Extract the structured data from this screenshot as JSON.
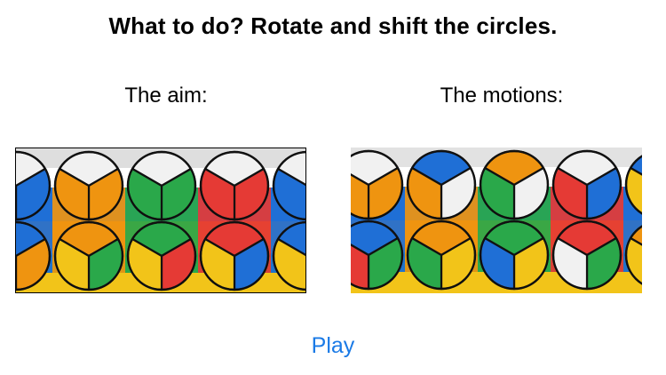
{
  "header": {
    "title": "What to do? Rotate and shift the circles."
  },
  "boards": {
    "aim": {
      "label": "The aim:",
      "backgrounds": [
        "#dedede",
        "#ffffff",
        "#1f6fd6",
        "#ef9410",
        "#2aa84a",
        "#e53a35",
        "#f2c419"
      ],
      "circles": [
        [
          "white",
          "blue",
          "blue"
        ],
        [
          "white",
          "orange",
          "orange"
        ],
        [
          "white",
          "green",
          "green"
        ],
        [
          "white",
          "red",
          "red"
        ],
        [
          "white",
          "blue",
          "blue"
        ],
        [
          "blue",
          "orange",
          "yellow"
        ],
        [
          "orange",
          "green",
          "yellow"
        ],
        [
          "green",
          "red",
          "yellow"
        ],
        [
          "red",
          "blue",
          "yellow"
        ],
        [
          "blue",
          "blue",
          "yellow"
        ]
      ]
    },
    "motions": {
      "label": "The motions:",
      "backgrounds": [
        "#e2e2e2",
        "#ffffff",
        "#1f6fd6",
        "#ef9410",
        "#2aa84a",
        "#e53a35",
        "#f2c419"
      ],
      "circles": [
        [
          "white",
          "orange",
          "orange"
        ],
        [
          "blue",
          "white",
          "orange"
        ],
        [
          "orange",
          "white",
          "green"
        ],
        [
          "white",
          "blue",
          "red"
        ],
        [
          "blue",
          "orange",
          "yellow"
        ],
        [
          "blue",
          "green",
          "red"
        ],
        [
          "orange",
          "yellow",
          "green"
        ],
        [
          "green",
          "yellow",
          "blue"
        ],
        [
          "red",
          "green",
          "white"
        ],
        [
          "orange",
          "blue",
          "yellow"
        ]
      ]
    }
  },
  "colors": {
    "white": "#f1f1f1",
    "blue": "#1f6fd6",
    "orange": "#ef9410",
    "green": "#2aa84a",
    "red": "#e53a35",
    "yellow": "#f2c419"
  },
  "actions": {
    "play_label": "Play"
  }
}
